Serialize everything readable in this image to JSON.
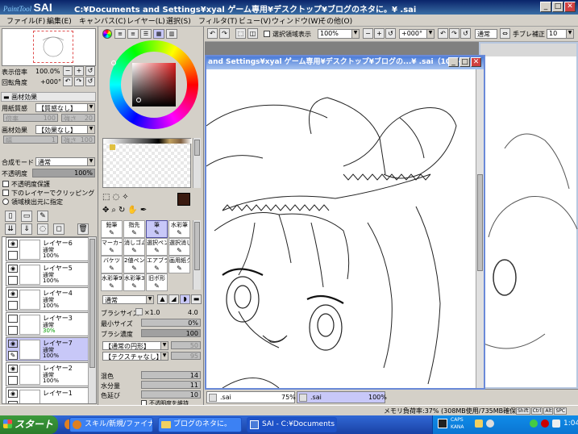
{
  "app": {
    "logo_small": "PaintTool",
    "logo_big": "SAI",
    "title_path": "C:¥Documents and Settings¥xyal ゲーム専用¥デスクトップ¥ブログのネタに。¥        .sai"
  },
  "menu": [
    "ファイル(F)",
    "編集(E)",
    "キャンバス(C)",
    "レイヤー(L)",
    "選択(S)",
    "フィルタ(T)",
    "ビュー(V)",
    "ウィンドウ(W)",
    "その他(O)"
  ],
  "navigator": {
    "zoom_label": "表示倍率",
    "zoom_value": "100.0%",
    "rotate_label": "回転角度",
    "rotate_value": "+000°"
  },
  "paper_effect": {
    "header": "画材効果",
    "texture_label": "用紙質感",
    "texture_value": "【質感なし】",
    "scale_label": "倍率",
    "scale_value": "100",
    "strength_label": "強さ",
    "strength_value": "20",
    "effect_label": "画材効果",
    "effect_value": "【効果なし】",
    "width_label": "幅",
    "width_value": "1",
    "strength2_label": "強さ",
    "strength2_value": "100"
  },
  "layer_panel": {
    "blend_label": "合成モード",
    "blend_value": "通常",
    "opacity_label": "不透明度",
    "opacity_value": "100%",
    "opacity_fraction": 1.0,
    "preserve_opacity": "不透明度保護",
    "clip_lower": "下のレイヤーでクリッピング",
    "area_select": "領域検出元に指定",
    "layers": [
      {
        "name": "レイヤー6",
        "mode": "通常",
        "opacity": "100%",
        "visible": true,
        "selected": false
      },
      {
        "name": "レイヤー5",
        "mode": "通常",
        "opacity": "100%",
        "visible": true,
        "selected": false
      },
      {
        "name": "レイヤー4",
        "mode": "通常",
        "opacity": "100%",
        "visible": true,
        "selected": false
      },
      {
        "name": "レイヤー3",
        "mode": "通常",
        "opacity": "30%",
        "visible": false,
        "selected": false
      },
      {
        "name": "レイヤー7",
        "mode": "通常",
        "opacity": "100%",
        "visible": true,
        "selected": true
      },
      {
        "name": "レイヤー2",
        "mode": "通常",
        "opacity": "100%",
        "visible": true,
        "selected": false
      },
      {
        "name": "レイヤー1",
        "mode": "",
        "opacity": "",
        "visible": true,
        "selected": false
      }
    ]
  },
  "tools": {
    "rows": [
      [
        "鉛筆",
        "指先",
        "筆",
        "水彩筆"
      ],
      [
        "マーカー",
        "消しゴム",
        "選択ペン",
        "選択消し"
      ],
      [
        "バケツ",
        "2値ペン",
        "エアブラシ",
        "画用紙クラック"
      ],
      [
        "水彩筆9号",
        "水彩筆3号",
        "旧ポ形",
        ""
      ]
    ],
    "selected": "筆",
    "blend_value": "通常",
    "brush_size_label": "ブラシサイズ",
    "brush_size_mult": "×1.0",
    "brush_size_value": "4.0",
    "min_size_label": "最小サイズ",
    "min_size_value": "0%",
    "density_label": "ブラシ濃度",
    "density_value": "100",
    "shape_value": "【通常の円形】",
    "shape_strength": "50",
    "texture_value": "【テクスチャなし】",
    "texture_strength": "95",
    "blend2_label": "混色",
    "blend2_value": "14",
    "water_label": "水分量",
    "water_value": "11",
    "stretch_label": "色延び",
    "stretch_value": "10",
    "keep_opacity_label": "不透明度を維持"
  },
  "canvas_toolbar": {
    "selection_visible_label": "選択領域表示",
    "zoom": "100%",
    "angle": "+000°",
    "blend": "通常",
    "stabilizer_label": "手ブレ補正",
    "stabilizer_value": "10"
  },
  "canvas_window": {
    "title": "and Settings¥xyal ゲーム専用¥デスクトップ¥ブログの...¥        .sai（100%）"
  },
  "doc_tabs": [
    {
      "name": "        .sai",
      "zoom": "75%",
      "active": false
    },
    {
      "name": "        .sai",
      "zoom": "100%",
      "active": true
    }
  ],
  "status": {
    "memory": "メモリ負荷率:37% (308MB使用/735MB確保)",
    "keys": [
      "Shift",
      "Ctrl",
      "Alt",
      "SPC",
      "Any"
    ]
  },
  "taskbar": {
    "start": "スタート",
    "tasks": [
      {
        "label": "スキル/新規/ファイナル...",
        "active": false
      },
      {
        "label": "ブログのネタに。",
        "active": false
      },
      {
        "label": "SAI - C:¥Documents ...",
        "active": true
      }
    ],
    "tray_caps": "CAPS",
    "tray_kana": "KANA",
    "clock": "1:04"
  },
  "colors": {
    "accent": "#0a246a",
    "selected_bg": "#c8c8f8",
    "primary_color": "#3a1a10"
  }
}
